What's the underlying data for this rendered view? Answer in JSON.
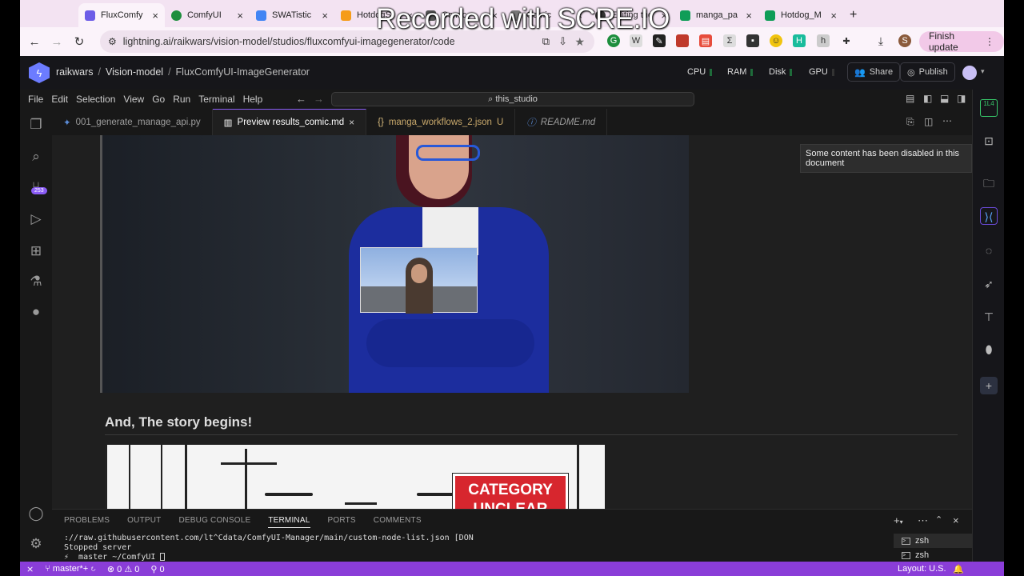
{
  "browser": {
    "tabs": [
      {
        "title": "FluxComfy",
        "color": "#6c5ce7",
        "active": true
      },
      {
        "title": "ComfyUI",
        "color": "#1e8e3e"
      },
      {
        "title": "SWATistic",
        "color": "#4285f4"
      },
      {
        "title": "HotdogS",
        "color": "#f59c1a"
      },
      {
        "title": "Comic",
        "color": "#555555"
      },
      {
        "title": "Comic",
        "color": "#555555"
      },
      {
        "title": "e-san",
        "color": "#999999"
      },
      {
        "title": "Editing the",
        "color": "#333333"
      },
      {
        "title": "manga_pa",
        "color": "#0f9d58"
      },
      {
        "title": "Hotdog_M",
        "color": "#0f9d58"
      }
    ],
    "url": "lightning.ai/raikwars/vision-model/studios/fluxcomfyui-imagegenerator/code",
    "finish_update": "Finish update",
    "profile_letter": "S"
  },
  "watermark": "Recorded with SCRE.IO",
  "app": {
    "breadcrumbs": [
      "raikwars",
      "Vision-model",
      "FluxComfyUI-ImageGenerator"
    ],
    "resources": [
      "CPU",
      "RAM",
      "Disk",
      "GPU"
    ],
    "share": "Share",
    "publish": "Publish"
  },
  "menu": [
    "File",
    "Edit",
    "Selection",
    "View",
    "Go",
    "Run",
    "Terminal",
    "Help"
  ],
  "command_center": "this_studio",
  "scm_badge": "253",
  "editor_tabs": [
    {
      "label": "001_generate_manage_api.py",
      "icon": "python-icon"
    },
    {
      "label": "Preview results_comic.md",
      "icon": "preview-icon",
      "active": true
    },
    {
      "label": "manga_workflows_2.json",
      "icon": "json-icon",
      "modified": "U"
    },
    {
      "label": "README.md",
      "icon": "info-icon"
    }
  ],
  "tooltip": "Some content has been disabled in this document",
  "heading": "And, The story begins!",
  "comic_sign": "CATEGORY UNCLEAR",
  "panel": {
    "tabs": [
      "PROBLEMS",
      "OUTPUT",
      "DEBUG CONSOLE",
      "TERMINAL",
      "PORTS",
      "COMMENTS"
    ],
    "active_tab": "TERMINAL",
    "terminal_lines": [
      "://raw.githubusercontent.com/lt^Cdata/ComfyUI-Manager/main/custom-node-list.json [DON",
      "Stopped server",
      "⚡  master ~/ComfyUI "
    ],
    "shells": [
      "zsh",
      "zsh"
    ]
  },
  "status": {
    "branch": "master*+",
    "errors": "0",
    "warnings": "0",
    "ports": "0",
    "layout": "Layout: U.S."
  },
  "right_sidebar_label": "1L4"
}
